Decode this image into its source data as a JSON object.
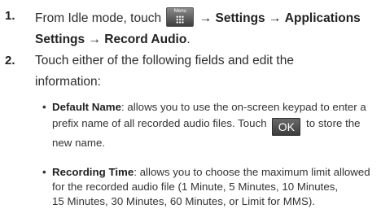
{
  "steps": [
    {
      "number": "1.",
      "prefix": "From Idle mode, touch",
      "menu_button_label": "Menu",
      "arrow": "→",
      "settings": "Settings",
      "applications_settings_line1": "Applications",
      "applications_settings_line2": "Settings",
      "record_audio": "Record Audio",
      "period": "."
    },
    {
      "number": "2.",
      "line1": "Touch either of the following fields and edit the",
      "line2": "information:"
    }
  ],
  "bullets": [
    {
      "term": "Default Name",
      "line1": ": allows you to use the on-screen keypad to enter a",
      "line2_pre": "prefix name of all recorded audio files. Touch",
      "ok_label": "OK",
      "line2_post": "to store the",
      "line3": "new name."
    },
    {
      "term": "Recording Time",
      "line1": ": allows you to choose the maximum limit allowed",
      "line2": "for the recorded audio file (1 Minute, 5 Minutes, 10 Minutes,",
      "line3": "15 Minutes, 30 Minutes, 60 Minutes, or Limit for MMS)."
    }
  ],
  "icons": {
    "menu": "menu-grid-icon",
    "bullet": "bullet-dot"
  }
}
